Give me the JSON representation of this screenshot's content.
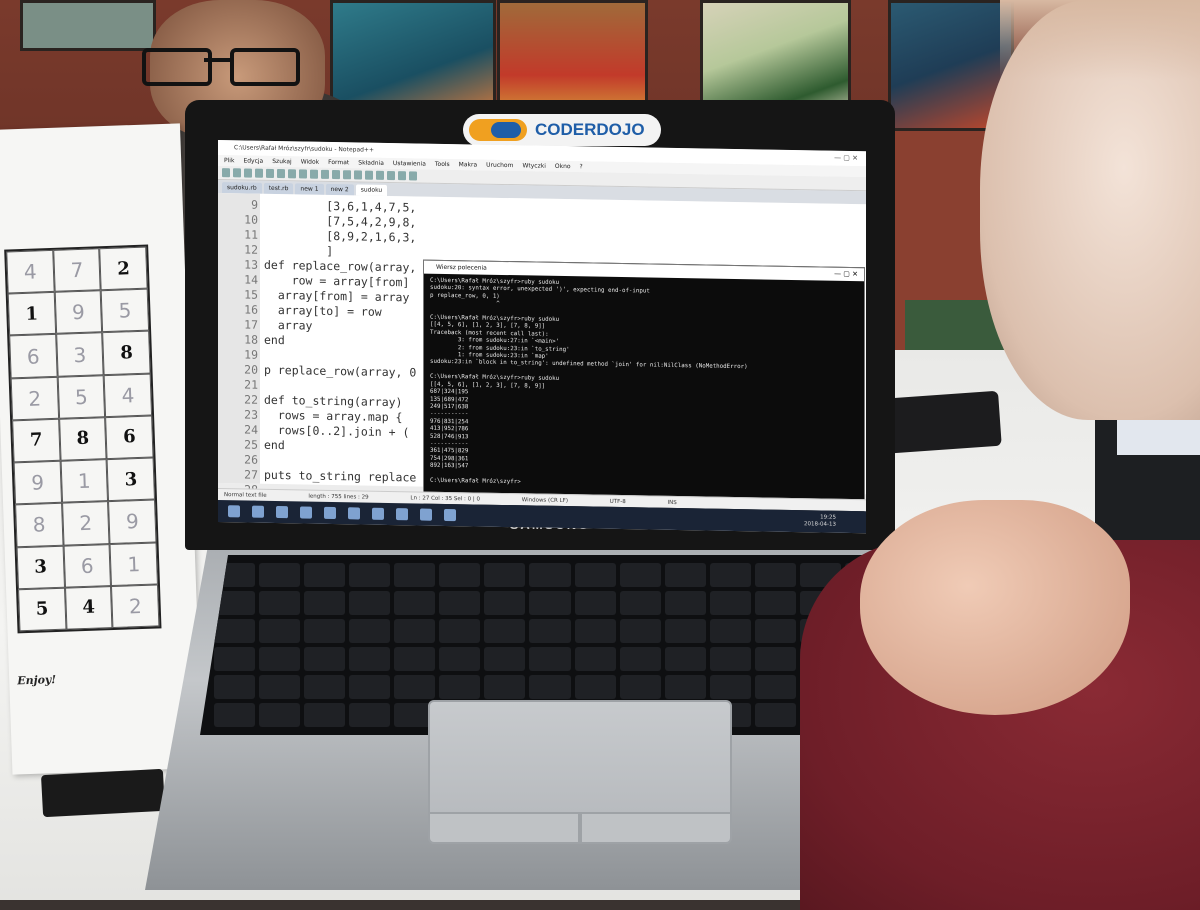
{
  "laptop": {
    "badge_text": "CODERDOJO",
    "brand": "SAMSUNG"
  },
  "notepad": {
    "title": "C:\\Users\\Rafał Mróz\\szyfr\\sudoku - Notepad++",
    "menu": [
      "Plik",
      "Edycja",
      "Szukaj",
      "Widok",
      "Format",
      "Składnia",
      "Ustawienia",
      "Tools",
      "Makra",
      "Uruchom",
      "Wtyczki",
      "Okno",
      "?"
    ],
    "tabs": [
      "sudoku.rb",
      "test.rb",
      "new 1",
      "new 2",
      "sudoku"
    ],
    "active_tab": "sudoku",
    "lines": [
      {
        "n": "9",
        "code": "         [3,6,1,4,7,5,"
      },
      {
        "n": "10",
        "code": "         [7,5,4,2,9,8,"
      },
      {
        "n": "11",
        "code": "         [8,9,2,1,6,3,"
      },
      {
        "n": "12",
        "code": "         ]"
      },
      {
        "n": "13",
        "code": "def replace_row(array,"
      },
      {
        "n": "14",
        "code": "    row = array[from]"
      },
      {
        "n": "15",
        "code": "  array[from] = array"
      },
      {
        "n": "16",
        "code": "  array[to] = row"
      },
      {
        "n": "17",
        "code": "  array"
      },
      {
        "n": "18",
        "code": "end"
      },
      {
        "n": "19",
        "code": ""
      },
      {
        "n": "20",
        "code": "p replace_row(array, 0"
      },
      {
        "n": "21",
        "code": ""
      },
      {
        "n": "22",
        "code": "def to_string(array)"
      },
      {
        "n": "23",
        "code": "  rows = array.map {"
      },
      {
        "n": "24",
        "code": "  rows[0..2].join + ("
      },
      {
        "n": "25",
        "code": "end"
      },
      {
        "n": "26",
        "code": ""
      },
      {
        "n": "27",
        "code": "puts to_string replace"
      },
      {
        "n": "28",
        "code": ""
      },
      {
        "n": "29",
        "code": ""
      }
    ],
    "status_left": "Normal text file",
    "status_length": "length : 755   lines : 29",
    "status_pos": "Ln : 27   Col : 35   Sel : 0 | 0",
    "status_eol": "Windows (CR LF)",
    "status_enc": "UTF-8",
    "status_ins": "INS"
  },
  "cmd": {
    "title": "Wiersz polecenia",
    "output": "C:\\Users\\Rafał Mróz\\szyfr>ruby sudoku\nsudoku:20: syntax error, unexpected ')', expecting end-of-input\np replace_row, 0, 1)\n                   ^\n\nC:\\Users\\Rafał Mróz\\szyfr>ruby sudoku\n[[4, 5, 6], [1, 2, 3], [7, 8, 9]]\nTraceback (most recent call last):\n        3: from sudoku:27:in `<main>'\n        2: from sudoku:23:in `to_string'\n        1: from sudoku:23:in `map'\nsudoku:23:in `block in to_string': undefined method `join' for nil:NilClass (NoMethodError)\n\nC:\\Users\\Rafał Mróz\\szyfr>ruby sudoku\n[[4, 5, 6], [1, 2, 3], [7, 8, 9]]\n687|324|195\n135|689|472\n249|517|638\n-----------\n976|831|254\n413|952|786\n528|746|913\n-----------\n361|475|829\n754|298|361\n892|163|547\n\nC:\\Users\\Rafał Mróz\\szyfr>"
  },
  "taskbar": {
    "time": "19:25",
    "date": "2018-04-13"
  },
  "sudoku_sheet": {
    "cells": [
      "4",
      "7",
      "2",
      "1",
      "9",
      "5",
      "6",
      "3",
      "8",
      "2",
      "5",
      "4",
      "7",
      "8",
      "6",
      "9",
      "1",
      "3",
      "8",
      "2",
      "9",
      "3",
      "6",
      "1",
      "5",
      "4",
      "2"
    ],
    "printed": [
      false,
      false,
      true,
      true,
      false,
      false,
      false,
      false,
      true,
      false,
      false,
      false,
      true,
      true,
      true,
      false,
      false,
      true,
      false,
      false,
      false,
      true,
      false,
      false,
      true,
      true,
      false
    ],
    "footer": "Enjoy!"
  }
}
